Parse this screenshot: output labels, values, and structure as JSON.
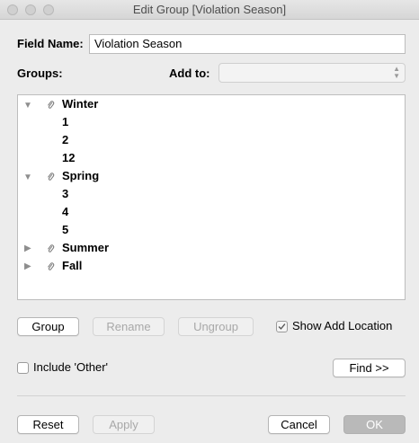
{
  "window": {
    "title": "Edit Group [Violation Season]"
  },
  "field_name": {
    "label": "Field Name:",
    "value": "Violation Season"
  },
  "groups_label": "Groups:",
  "add_to": {
    "label": "Add to:",
    "value": ""
  },
  "tree": {
    "groups": [
      {
        "name": "Winter",
        "expanded": true,
        "members": [
          "1",
          "2",
          "12"
        ]
      },
      {
        "name": "Spring",
        "expanded": true,
        "members": [
          "3",
          "4",
          "5"
        ]
      },
      {
        "name": "Summer",
        "expanded": false,
        "members": []
      },
      {
        "name": "Fall",
        "expanded": false,
        "members": []
      }
    ]
  },
  "buttons": {
    "group": "Group",
    "rename": "Rename",
    "ungroup": "Ungroup",
    "find": "Find >>",
    "reset": "Reset",
    "apply": "Apply",
    "cancel": "Cancel",
    "ok": "OK"
  },
  "show_add_location": {
    "label": "Show Add Location",
    "checked": true
  },
  "include_other": {
    "label": "Include 'Other'",
    "checked": false
  },
  "icons": {
    "expanded": "triangle-down",
    "collapsed": "triangle-right",
    "group_item": "paperclip",
    "select_arrows": "up-down-chevrons"
  }
}
